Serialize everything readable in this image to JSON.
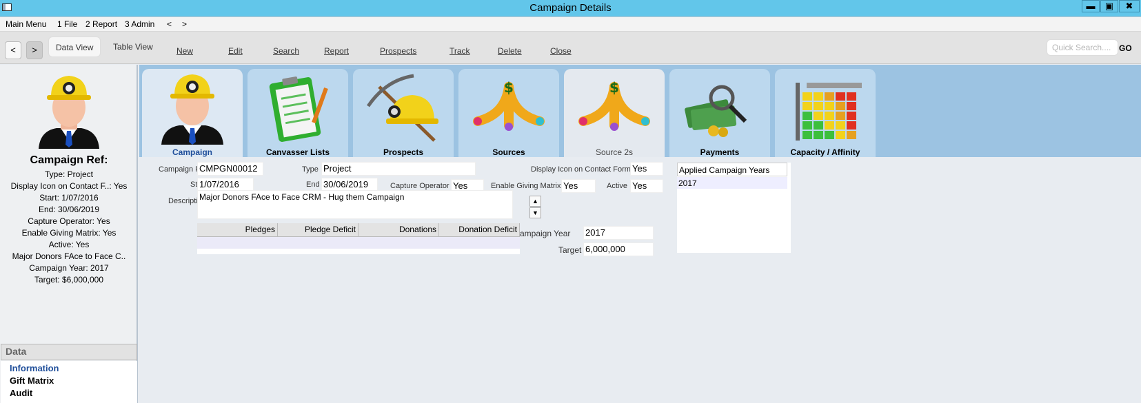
{
  "window": {
    "title": "Campaign Details",
    "min": "▬",
    "max": "▣",
    "close": "✖"
  },
  "menu": {
    "items": [
      "Main Menu",
      "1 File",
      "2 Report",
      "3 Admin",
      "<",
      ">"
    ]
  },
  "toolbar": {
    "back": "<",
    "forward": ">",
    "views": [
      "Data View",
      "Table View"
    ],
    "buttons": [
      "New",
      "Edit",
      "Search",
      "Report",
      "Prospects",
      "Track",
      "Delete",
      "Close"
    ],
    "quick_placeholder": "Quick Search....",
    "go": "GO"
  },
  "sidebar": {
    "title": "Campaign Ref:",
    "lines": [
      "Type: Project",
      "Display Icon on Contact F..: Yes",
      "Start: 1/07/2016",
      "End: 30/06/2019",
      "Capture Operator: Yes",
      "Enable Giving Matrix: Yes",
      "Active: Yes",
      "Major Donors FAce to Face C..",
      "Campaign Year: 2017",
      "Target: $6,000,000"
    ],
    "data_header": "Data",
    "data_items": [
      "Information",
      "Gift Matrix",
      "Audit"
    ]
  },
  "tabs": [
    "Campaign",
    "Canvasser Lists",
    "Prospects",
    "Sources",
    "Source 2s",
    "Payments",
    "Capacity / Affinity"
  ],
  "form": {
    "campaign_ref_label": "Campaign Ref",
    "campaign_ref": "CMPGN00012",
    "type_label": "Type",
    "type": "Project",
    "display_icon_label": "Display Icon on Contact Form",
    "display_icon": "Yes",
    "start_label": "Start",
    "start": "1/07/2016",
    "end_label": "End",
    "end": "30/06/2019",
    "capture_label": "Capture Operator",
    "capture": "Yes",
    "giving_label": "Enable Giving Matrix",
    "giving": "Yes",
    "active_label": "Active",
    "active": "Yes",
    "description_label": "Description",
    "description": "Major Donors FAce to Face CRM - Hug them Campaign",
    "grid_headers": [
      "Pledges",
      "Pledge Deficit",
      "Donations",
      "Donation Deficit"
    ],
    "year_label": "ampaign Year",
    "year": "2017",
    "target_label": "Target",
    "target": "6,000,000"
  },
  "years": {
    "header": "Applied Campaign Years",
    "rows": [
      "2017"
    ]
  },
  "colors": {
    "titlebar": "#62c6ea",
    "tabband": "#9cc3e2",
    "tab": "#bcd8ee",
    "active_tab_label": "#1f4e9a"
  }
}
